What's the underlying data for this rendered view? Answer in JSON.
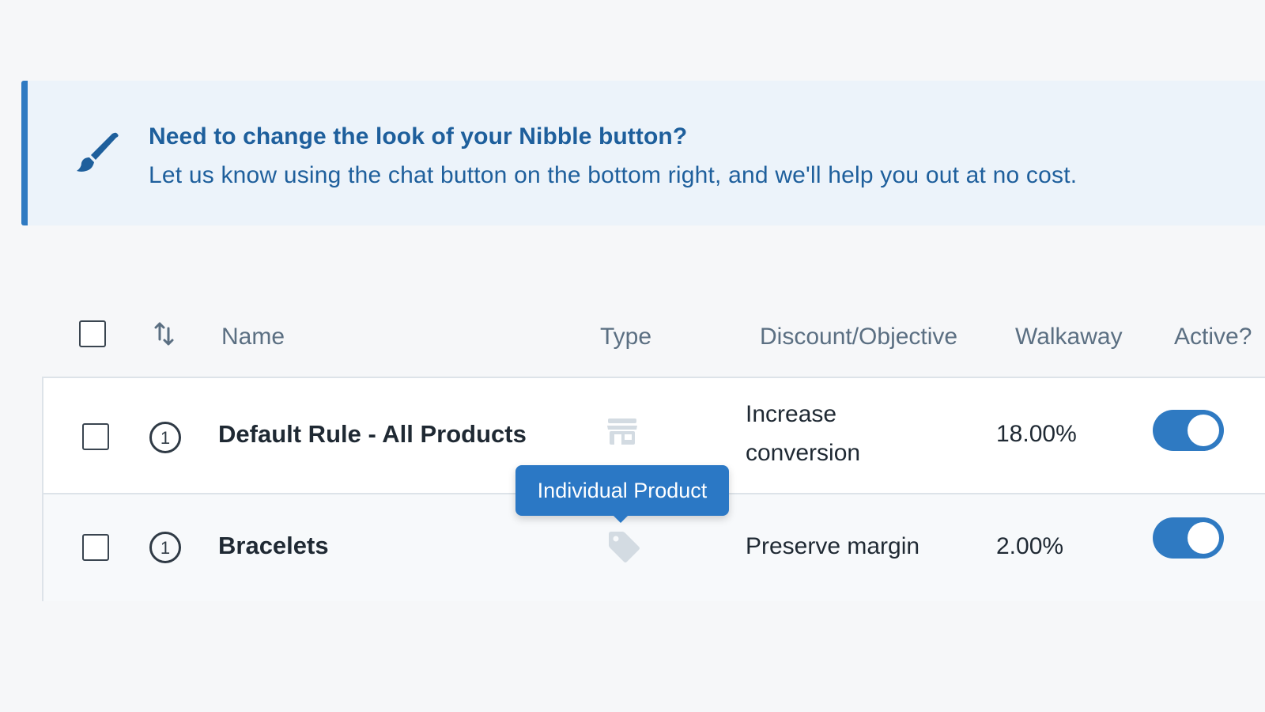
{
  "banner": {
    "icon": "paintbrush-icon",
    "title": "Need to change the look of your Nibble button?",
    "body": "Let us know using the chat button on the bottom right, and we'll help you out at no cost."
  },
  "table": {
    "headers": {
      "name": "Name",
      "type": "Type",
      "objective": "Discount/Objective",
      "walkaway": "Walkaway",
      "active": "Active?"
    },
    "rows": [
      {
        "priority": "1",
        "name": "Default Rule - All Products",
        "type_icon": "store-icon",
        "objective_line1": "Increase",
        "objective_line2": "conversion",
        "walkaway": "18.00%",
        "active": true
      },
      {
        "priority": "1",
        "name": "Bracelets",
        "type_icon": "tag-icon",
        "objective": "Preserve margin",
        "walkaway": "2.00%",
        "active": true
      }
    ]
  },
  "tooltip": {
    "text": "Individual Product"
  },
  "colors": {
    "accent": "#2f7ac2",
    "banner_bg": "#ecf3fa",
    "banner_text": "#1e5f9c",
    "header_text": "#5b6f82"
  }
}
